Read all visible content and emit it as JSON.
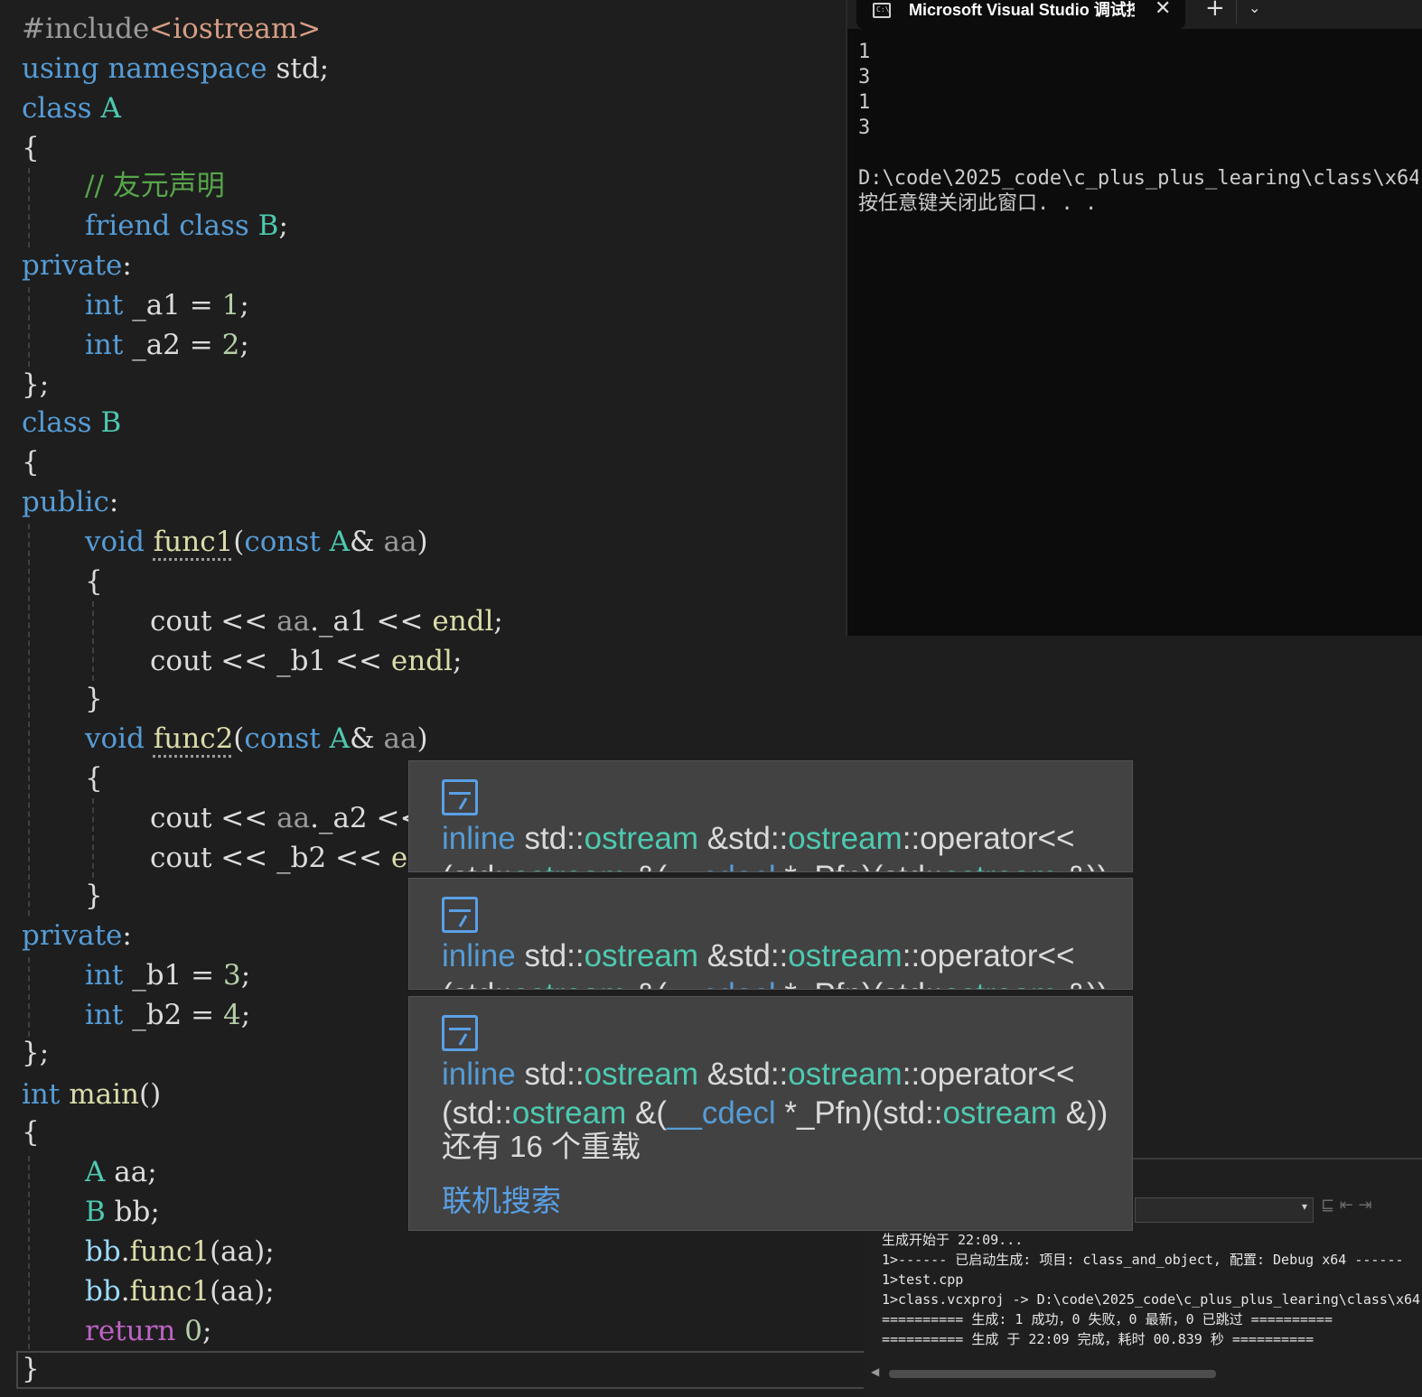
{
  "editor": {
    "lines": {
      "l1": {
        "pp": "#include",
        "inc": "<iostream>"
      },
      "l2": {
        "kw1": "using",
        "kw2": "namespace",
        "rest": " std;"
      },
      "l3": {
        "kw": "class",
        "ty": "A"
      },
      "l4": {
        "t": "{"
      },
      "l5": {
        "cm": "// 友元声明"
      },
      "l6": {
        "kw1": "friend",
        "kw2": "class",
        "ty": "B",
        "rest": ";"
      },
      "l7": {
        "kw": "private",
        "rest": ":"
      },
      "l8": {
        "kw": "int",
        "name": "_a1",
        "op": " = ",
        "num": "1",
        "rest": ";"
      },
      "l9": {
        "kw": "int",
        "name": "_a2",
        "op": " = ",
        "num": "2",
        "rest": ";"
      },
      "l10": {
        "t": "};"
      },
      "l11": {
        "kw": "class",
        "ty": "B"
      },
      "l12": {
        "t": "{"
      },
      "l13": {
        "kw": "public",
        "rest": ":"
      },
      "l14": {
        "kw": "void",
        "fn": "func1",
        "p1": "(",
        "kw2": "const",
        "ty": "A",
        "amp": "&",
        "param": "aa",
        "p2": ")"
      },
      "l15": {
        "t": "{"
      },
      "l16": {
        "a": "cout",
        "b": " << ",
        "c": "aa",
        "d": ".",
        "e": "_a1",
        "f": " << ",
        "g": "endl",
        "h": ";"
      },
      "l17": {
        "a": "cout",
        "b": " << ",
        "e": "_b1",
        "f": " << ",
        "g": "endl",
        "h": ";"
      },
      "l18": {
        "t": "}"
      },
      "l19": {
        "kw": "void",
        "fn": "func2",
        "p1": "(",
        "kw2": "const",
        "ty": "A",
        "amp": "&",
        "param": "aa",
        "p2": ")"
      },
      "l20": {
        "t": "{"
      },
      "l21": {
        "a": "cout",
        "b": " << ",
        "c": "aa",
        "d": ".",
        "e": "_a2",
        "f": " <<"
      },
      "l22": {
        "a": "cout",
        "b": " << ",
        "e": "_b2",
        "f": " << ",
        "g": "e"
      },
      "l23": {
        "t": "}"
      },
      "l24": {
        "kw": "private",
        "rest": ":"
      },
      "l25": {
        "kw": "int",
        "name": "_b1",
        "op": " = ",
        "num": "3",
        "rest": ";"
      },
      "l26": {
        "kw": "int",
        "name": "_b2",
        "op": " = ",
        "num": "4",
        "rest": ";"
      },
      "l27": {
        "t": "};"
      },
      "l28": {
        "kw": "int",
        "fn": "main",
        "rest": "()"
      },
      "l29": {
        "t": "{"
      },
      "l30": {
        "ty": "A",
        "rest": " aa;"
      },
      "l31": {
        "ty": "B",
        "rest": " bb;"
      },
      "l32": {
        "obj": "bb",
        "d": ".",
        "fn": "func1",
        "rest": "(aa);"
      },
      "l33": {
        "obj": "bb",
        "d": ".",
        "fn": "func1",
        "rest": "(aa);"
      },
      "l34": {
        "kw": "return",
        "num": "0",
        "rest": ";"
      },
      "l35": {
        "t": "}"
      }
    }
  },
  "console": {
    "tab_icon": "C:\\",
    "tab_title": "Microsoft Visual Studio 调试控制台",
    "close_glyph": "✕",
    "add_glyph": "+",
    "dropdown_glyph": "⌄",
    "output": "1\n3\n1\n3\n\nD:\\code\\2025_code\\c_plus_plus_learing\\class\\x64\n按任意键关闭此窗口. . ."
  },
  "tooltip": {
    "kw_inline": "inline",
    "std": "std",
    "sep": "::",
    "ostream": "ostream",
    "amp_std": " &std",
    "operator": "::operator<<",
    "open_paren": "(std",
    "amp_paren": " &(",
    "cdecl": "__cdecl",
    "pfn": " *_Pfn)(std",
    "amp_close": " &))",
    "more_overloads": "还有 16 个重载",
    "online_search": "联机搜索"
  },
  "output_pane": {
    "combo_arrow": "▾",
    "tools": "⊑ ⇤ ⇥",
    "scroll_left": "◀",
    "log": "生成开始于 22:09...\n1>------ 已启动生成: 项目: class_and_object, 配置: Debug x64 ------\n1>test.cpp\n1>class.vcxproj -> D:\\code\\2025_code\\c_plus_plus_learing\\class\\x64\n========== 生成: 1 成功，0 失败，0 最新，0 已跳过 ==========\n========== 生成 于 22:09 完成，耗时 00.839 秒 =========="
  },
  "colors": {
    "keyword": "#569cd6",
    "type": "#4ec9b0",
    "function": "#dcdcaa",
    "number": "#b5cea8",
    "string": "#d69d85",
    "comment": "#57a64a",
    "link": "#5aa0e6"
  }
}
